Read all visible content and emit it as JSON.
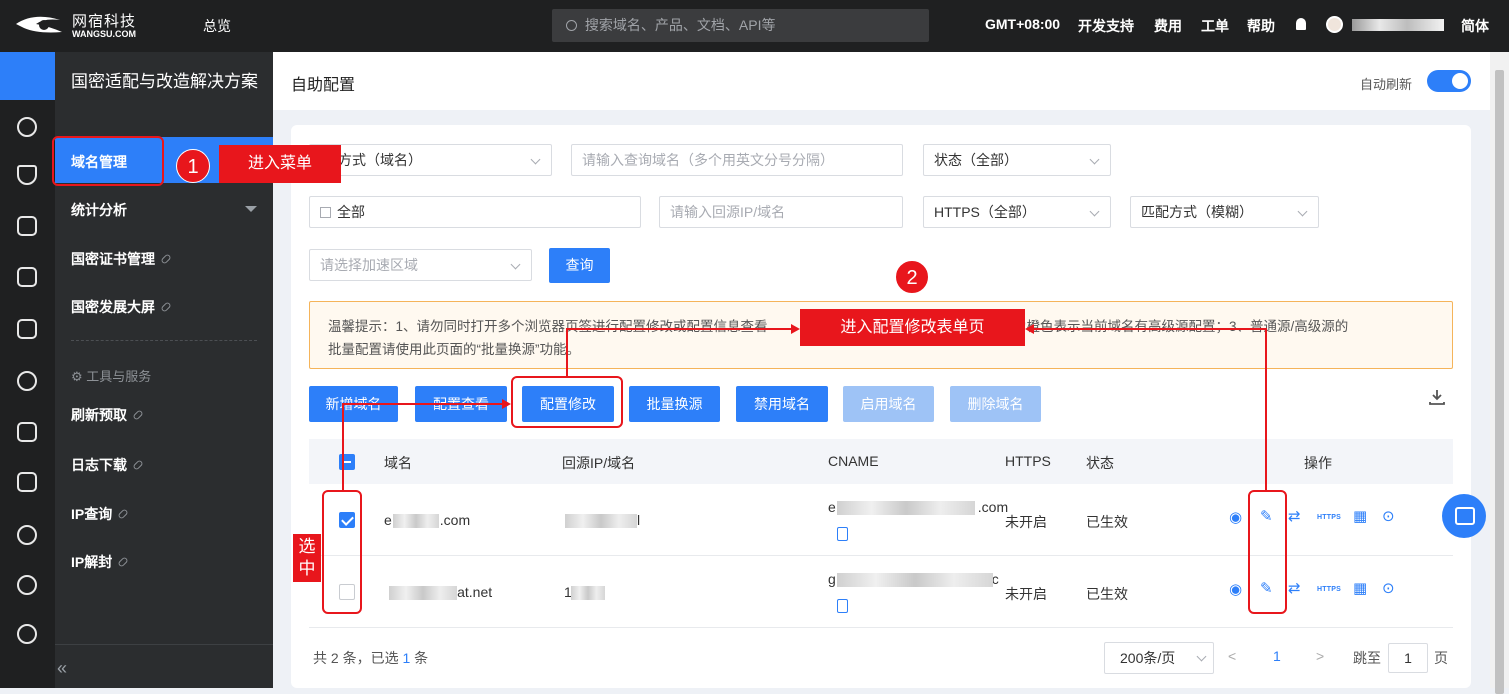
{
  "topbar": {
    "brand_cn": "网宿科技",
    "brand_en": "WANGSU.COM",
    "overview": "总览",
    "search_placeholder": "搜索域名、产品、文档、API等",
    "timezone": "GMT+08:00",
    "dev_support": "开发支持",
    "billing": "费用",
    "tickets": "工单",
    "help": "帮助",
    "language": "简体"
  },
  "sidebar": {
    "title": "国密适配与改造解决方案",
    "items": [
      {
        "label": "域名管理"
      },
      {
        "label": "统计分析"
      },
      {
        "label": "国密证书管理"
      },
      {
        "label": "国密发展大屏"
      },
      {
        "label": "刷新预取"
      },
      {
        "label": "日志下载"
      },
      {
        "label": "IP查询"
      },
      {
        "label": "IP解封"
      }
    ],
    "tools_section": "工具与服务",
    "collapse": "«"
  },
  "header": {
    "title": "自助配置",
    "auto_refresh": "自动刷新"
  },
  "filters": {
    "query_type": "方式（域名）",
    "domain_placeholder": "请输入查询域名（多个用英文分号分隔）",
    "status": "状态（全部）",
    "date": "全部",
    "origin_placeholder": "请输入回源IP/域名",
    "https": "HTTPS（全部）",
    "match": "匹配方式（模糊）",
    "region_placeholder": "请选择加速区域",
    "search_btn": "查询"
  },
  "notice": {
    "line1a": "温馨提示：1、请勿同时打开多个浏览器页签进行配置修改或配置信息查看",
    "line1b": "名为橙色表示当前域名有高级源配置；3、普通源/高级源的",
    "line2": "批量配置请使用此页面的“批量换源”功能。"
  },
  "actions": {
    "add": "新增域名",
    "view": "配置查看",
    "modify": "配置修改",
    "batch_origin": "批量换源",
    "disable": "禁用域名",
    "enable": "启用域名",
    "delete": "删除域名"
  },
  "table": {
    "headers": {
      "domain": "域名",
      "origin": "回源IP/域名",
      "cname": "CNAME",
      "https": "HTTPS",
      "status": "状态",
      "ops": "操作"
    },
    "rows": [
      {
        "domain_prefix": "e",
        "domain_suffix": ".com",
        "cname_prefix": "e",
        "cname_suffix": ".com",
        "https": "未开启",
        "status": "已生效",
        "origin_suffix": "l",
        "checked": true
      },
      {
        "domain_prefix": "",
        "domain_suffix": "lat.net",
        "cname_prefix": "g",
        "cname_suffix": "c",
        "https": "未开启",
        "status": "已生效",
        "origin_suffix": "1",
        "checked": false
      }
    ],
    "https_op": "HTTPS"
  },
  "pagination": {
    "total_prefix": "共 2 条，已选 ",
    "selected": "1",
    "total_suffix": " 条",
    "page_size": "200条/页",
    "prev": "<",
    "current": "1",
    "next": ">",
    "jump_label": "跳至",
    "jump_value": "1",
    "page_unit": "页"
  },
  "annotations": {
    "step1_num": "1",
    "step1_text": "进入菜单",
    "step2_num": "2",
    "step2_text": "进入配置修改表单页",
    "select_text": "选中"
  },
  "colors": {
    "primary": "#2d7ff9",
    "annotation": "#e8161c",
    "topbar_bg": "#1f2021",
    "notice_border": "#f5b45a"
  }
}
